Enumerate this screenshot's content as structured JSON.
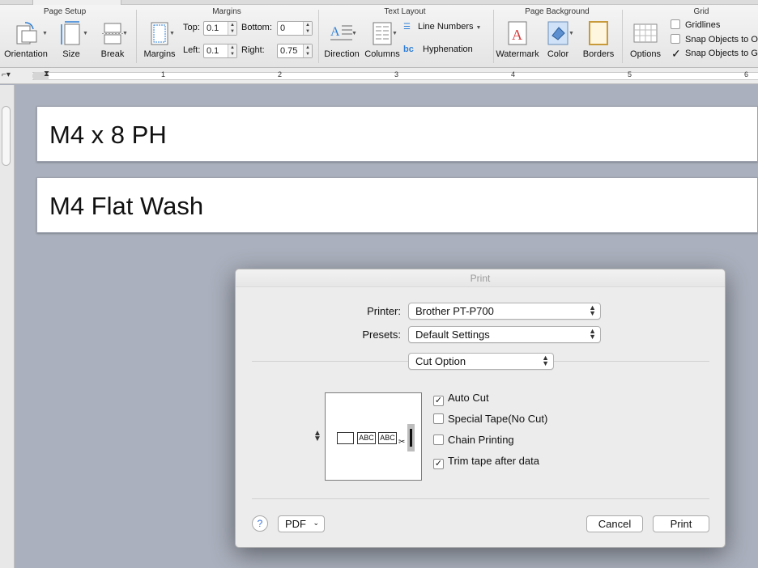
{
  "ribbon": {
    "groups": {
      "page_setup": "Page Setup",
      "margins": "Margins",
      "text_layout": "Text Layout",
      "page_background": "Page Background",
      "grid": "Grid"
    },
    "buttons": {
      "orientation": "Orientation",
      "size": "Size",
      "break": "Break",
      "margins": "Margins",
      "direction": "Direction",
      "columns": "Columns",
      "watermark": "Watermark",
      "color": "Color",
      "borders": "Borders",
      "options": "Options"
    },
    "margins": {
      "top_label": "Top:",
      "top_value": "0.1",
      "bottom_label": "Bottom:",
      "bottom_value": "0",
      "left_label": "Left:",
      "left_value": "0.1",
      "right_label": "Right:",
      "right_value": "0.75"
    },
    "text_layout": {
      "line_numbers": "Line Numbers",
      "hyphenation": "Hyphenation"
    },
    "grid": {
      "gridlines": "Gridlines",
      "gridlines_checked": false,
      "snap_objects_1": "Snap Objects to O",
      "snap_objects_1_checked": false,
      "snap_objects_2": "Snap Objects to G",
      "snap_objects_2_checked": true
    }
  },
  "ruler": {
    "numbers": [
      "1",
      "2",
      "3",
      "4",
      "5",
      "6"
    ]
  },
  "document": {
    "labels": [
      "M4 x 8 PH",
      "M4 Flat Wash"
    ]
  },
  "print_dialog": {
    "title": "Print",
    "printer_label": "Printer:",
    "printer_value": "Brother PT-P700",
    "presets_label": "Presets:",
    "presets_value": "Default Settings",
    "section_value": "Cut Option",
    "preview_cells": [
      "ABC",
      "ABC"
    ],
    "options": [
      {
        "label": "Auto Cut",
        "checked": true
      },
      {
        "label": "Special Tape(No Cut)",
        "checked": false
      },
      {
        "label": "Chain Printing",
        "checked": false
      },
      {
        "label": "Trim tape after data",
        "checked": true
      }
    ],
    "help": "?",
    "pdf_label": "PDF",
    "cancel_label": "Cancel",
    "print_label": "Print"
  },
  "colors": {
    "workspace": "#aab0bd",
    "dialog": "#ececec",
    "accent": "#3a73d9"
  }
}
